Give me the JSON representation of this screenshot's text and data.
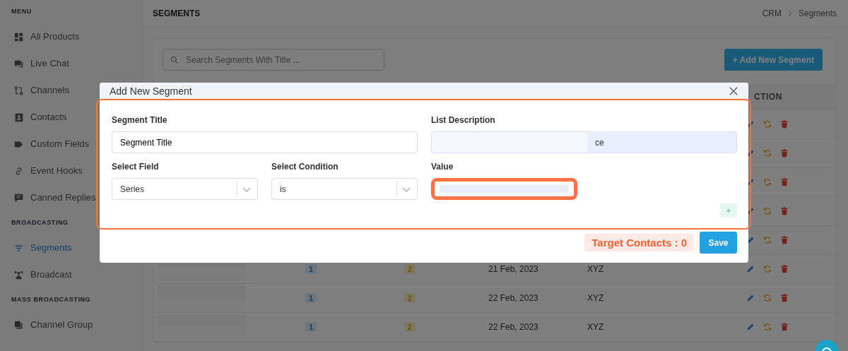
{
  "sidebar": {
    "sections": [
      {
        "heading": "MENU",
        "items": [
          {
            "label": "All Products",
            "selected": false
          },
          {
            "label": "Live Chat",
            "selected": false
          },
          {
            "label": "Channels",
            "selected": false
          },
          {
            "label": "Contacts",
            "selected": false
          },
          {
            "label": "Custom Fields",
            "selected": false
          },
          {
            "label": "Event Hooks",
            "selected": false
          },
          {
            "label": "Canned Replies",
            "selected": false
          }
        ]
      },
      {
        "heading": "BROADCASTING",
        "items": [
          {
            "label": "Segments",
            "selected": true
          },
          {
            "label": "Broadcast",
            "selected": false
          }
        ]
      },
      {
        "heading": "MASS BROADCASTING",
        "items": [
          {
            "label": "Channel Group",
            "selected": false
          }
        ]
      }
    ]
  },
  "page_header": {
    "title": "SEGMENTS",
    "breadcrumb": [
      "CRM",
      "Segments"
    ]
  },
  "search": {
    "placeholder": "Search Segments With Title ..."
  },
  "add_button": {
    "label": "+ Add New Segment"
  },
  "table": {
    "columns": [
      "CTION"
    ],
    "rows": [
      {
        "kind": "covered"
      },
      {
        "kind": "covered"
      },
      {
        "kind": "covered"
      },
      {
        "kind": "covered"
      },
      {
        "kind": "covered"
      },
      {
        "kind": "full",
        "column_2": "1",
        "column_3": "2",
        "column_4": "21 Feb, 2023",
        "column_5": "XYZ"
      },
      {
        "kind": "full",
        "column_2": "1",
        "column_3": "2",
        "column_4": "22 Feb, 2023",
        "column_5": "XYZ"
      },
      {
        "kind": "full",
        "column_2": "1",
        "column_3": "2",
        "column_4": "22 Feb, 2023",
        "column_5": "XYZ"
      }
    ]
  },
  "modal": {
    "title": "Add New Segment",
    "segment_title": {
      "label": "Segment Title",
      "value": "Segment Title"
    },
    "list_description": {
      "label": "List Description",
      "value": "ce"
    },
    "select_field": {
      "label": "Select Field",
      "value": "Series"
    },
    "select_condition": {
      "label": "Select Condition",
      "value": "is"
    },
    "value": {
      "label": "Value"
    },
    "add_condition_button": {
      "label": "+"
    },
    "target_contacts": "Target Contacts : 0",
    "save_button": {
      "label": "Save"
    }
  }
}
